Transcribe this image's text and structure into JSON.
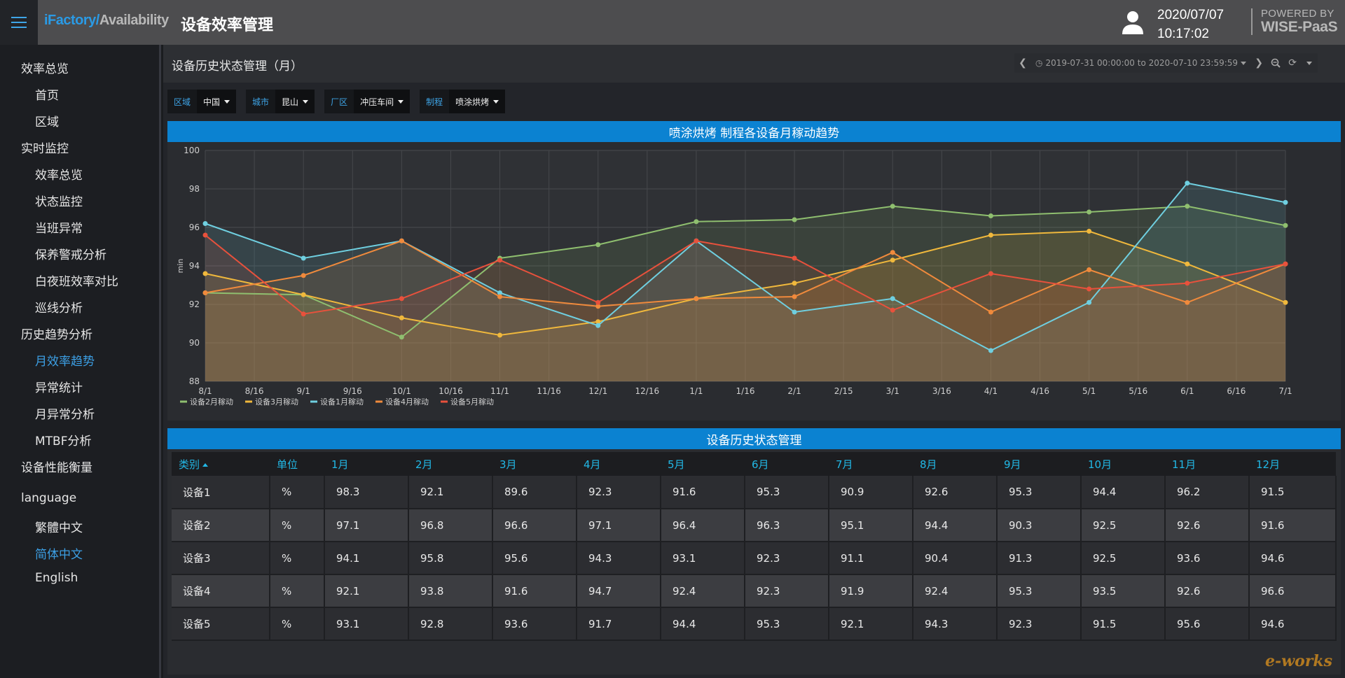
{
  "topbar": {
    "logo_part1": "iFactory/",
    "logo_part2": "Availability",
    "title": "设备效率管理",
    "date": "2020/07/07",
    "time": "10:17:02",
    "powered_line1": "POWERED BY",
    "powered_line2": "WISE-PaaS"
  },
  "sidebar": {
    "groups": [
      {
        "label": "效率总览",
        "items": [
          "首页",
          "区域"
        ]
      },
      {
        "label": "实时监控",
        "items": [
          "效率总览",
          "状态监控",
          "当班异常",
          "保养警戒分析",
          "白夜班效率对比",
          "巡线分析"
        ]
      },
      {
        "label": "历史趋势分析",
        "items": [
          "月效率趋势",
          "异常统计",
          "月异常分析",
          "MTBF分析"
        ]
      },
      {
        "label": "设备性能衡量",
        "items": []
      },
      {
        "label": "language",
        "items": [
          "繁體中文",
          "简体中文",
          "English"
        ]
      }
    ],
    "active_items": [
      "月效率趋势",
      "简体中文"
    ],
    "accent_color": "#3c9fe4"
  },
  "page": {
    "title": "设备历史状态管理（月）",
    "time_range": "2019-07-31 00:00:00 to 2020-07-10 23:59:59"
  },
  "filters": [
    {
      "label": "区域",
      "value": "中国"
    },
    {
      "label": "城市",
      "value": "昆山"
    },
    {
      "label": "厂区",
      "value": "冲压车间"
    },
    {
      "label": "制程",
      "value": "喷涂烘烤"
    }
  ],
  "chart_panel": {
    "title": "喷涂烘烤 制程各设备月稼动趋势"
  },
  "chart_data": {
    "type": "area",
    "title": "喷涂烘烤 制程各设备月稼动趋势",
    "xlabel": "",
    "ylabel": "min",
    "ylim": [
      88,
      100
    ],
    "yticks": [
      88,
      90,
      92,
      94,
      96,
      98,
      100
    ],
    "x_tick_labels": [
      "8/1",
      "8/16",
      "9/1",
      "9/16",
      "10/1",
      "10/16",
      "11/1",
      "11/16",
      "12/1",
      "12/16",
      "1/1",
      "1/16",
      "2/1",
      "2/15",
      "3/1",
      "3/16",
      "4/1",
      "4/16",
      "5/1",
      "5/16",
      "6/1",
      "6/16",
      "7/1"
    ],
    "categories": [
      "8/1",
      "9/1",
      "10/1",
      "11/1",
      "12/1",
      "1/1",
      "2/1",
      "3/1",
      "4/1",
      "5/1",
      "6/1",
      "7/1"
    ],
    "series": [
      {
        "name": "设备2月稼动",
        "color": "#8fbf6f",
        "values": [
          92.6,
          92.5,
          90.3,
          94.4,
          95.1,
          96.3,
          96.4,
          97.1,
          96.6,
          96.8,
          97.1,
          96.1
        ]
      },
      {
        "name": "设备3月稼动",
        "color": "#f0b83c",
        "values": [
          93.6,
          92.5,
          91.3,
          90.4,
          91.1,
          92.3,
          93.1,
          94.3,
          95.6,
          95.8,
          94.1,
          92.1
        ]
      },
      {
        "name": "设备1月稼动",
        "color": "#6fcfe0",
        "values": [
          96.2,
          94.4,
          95.3,
          92.6,
          90.9,
          95.3,
          91.6,
          92.3,
          89.6,
          92.1,
          98.3,
          97.3
        ]
      },
      {
        "name": "设备4月稼动",
        "color": "#f08a3c",
        "values": [
          92.6,
          93.5,
          95.3,
          92.4,
          91.9,
          92.3,
          92.4,
          94.7,
          91.6,
          93.8,
          92.1,
          94.1
        ]
      },
      {
        "name": "设备5月稼动",
        "color": "#e8513c",
        "values": [
          95.6,
          91.5,
          92.3,
          94.3,
          92.1,
          95.3,
          94.4,
          91.7,
          93.6,
          92.8,
          93.1,
          94.1
        ]
      }
    ],
    "grid": true,
    "legend": "bottom-left"
  },
  "table_panel": {
    "title": "设备历史状态管理",
    "headers": [
      "类别",
      "单位",
      "1月",
      "2月",
      "3月",
      "4月",
      "5月",
      "6月",
      "7月",
      "8月",
      "9月",
      "10月",
      "11月",
      "12月"
    ],
    "rows": [
      [
        "设备1",
        "%",
        "98.3",
        "92.1",
        "89.6",
        "92.3",
        "91.6",
        "95.3",
        "90.9",
        "92.6",
        "95.3",
        "94.4",
        "96.2",
        "91.5"
      ],
      [
        "设备2",
        "%",
        "97.1",
        "96.8",
        "96.6",
        "97.1",
        "96.4",
        "96.3",
        "95.1",
        "94.4",
        "90.3",
        "92.5",
        "92.6",
        "91.6"
      ],
      [
        "设备3",
        "%",
        "94.1",
        "95.8",
        "95.6",
        "94.3",
        "93.1",
        "92.3",
        "91.1",
        "90.4",
        "91.3",
        "92.5",
        "93.6",
        "94.6"
      ],
      [
        "设备4",
        "%",
        "92.1",
        "93.8",
        "91.6",
        "94.7",
        "92.4",
        "92.3",
        "91.9",
        "92.4",
        "95.3",
        "93.5",
        "92.6",
        "96.6"
      ],
      [
        "设备5",
        "%",
        "93.1",
        "92.8",
        "93.6",
        "91.7",
        "94.4",
        "95.3",
        "92.1",
        "94.3",
        "92.3",
        "91.5",
        "95.6",
        "94.6"
      ]
    ]
  },
  "watermark": "e-works"
}
